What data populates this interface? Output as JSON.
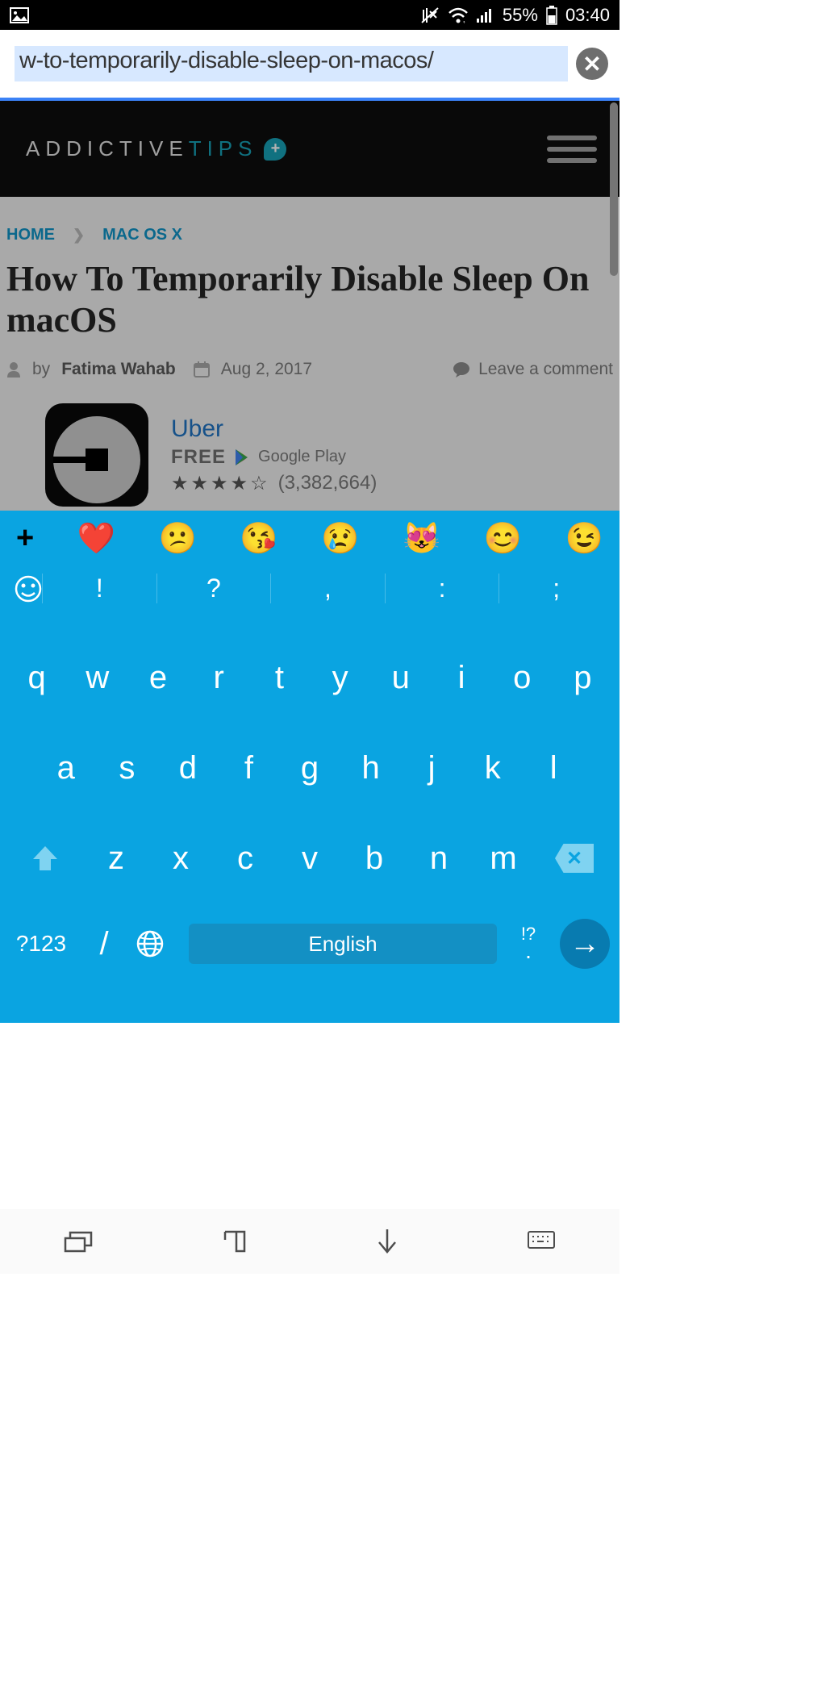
{
  "statusbar": {
    "battery_pct": "55%",
    "time": "03:40"
  },
  "urlbar": {
    "value": "w-to-temporarily-disable-sleep-on-macos/"
  },
  "site": {
    "logo1": "ADDICTIVE",
    "logo2": "TIPS",
    "crumb_home": "HOME",
    "crumb_cat": "MAC OS X",
    "title": "How To Temporarily Disable Sleep On macOS",
    "by": "by",
    "author": "Fatima Wahab",
    "date": "Aug 2, 2017",
    "leave_comment": "Leave a comment"
  },
  "ad": {
    "name": "Uber",
    "price": "FREE",
    "store": "Google Play",
    "stars": "★★★★☆",
    "count": "(3,382,664)"
  },
  "keyboard": {
    "emoji": [
      "❤️",
      "😕",
      "😘",
      "😢",
      "😻",
      "😊",
      "😉"
    ],
    "punct": [
      "!",
      "?",
      ",",
      ":",
      ";"
    ],
    "row1": [
      "q",
      "w",
      "e",
      "r",
      "t",
      "y",
      "u",
      "i",
      "o",
      "p"
    ],
    "row2": [
      "a",
      "s",
      "d",
      "f",
      "g",
      "h",
      "j",
      "k",
      "l"
    ],
    "row3": [
      "z",
      "x",
      "c",
      "v",
      "b",
      "n",
      "m"
    ],
    "numbers": "?123",
    "slash": "/",
    "space": "English",
    "iq_top": "!?",
    "iq_bot": "."
  }
}
